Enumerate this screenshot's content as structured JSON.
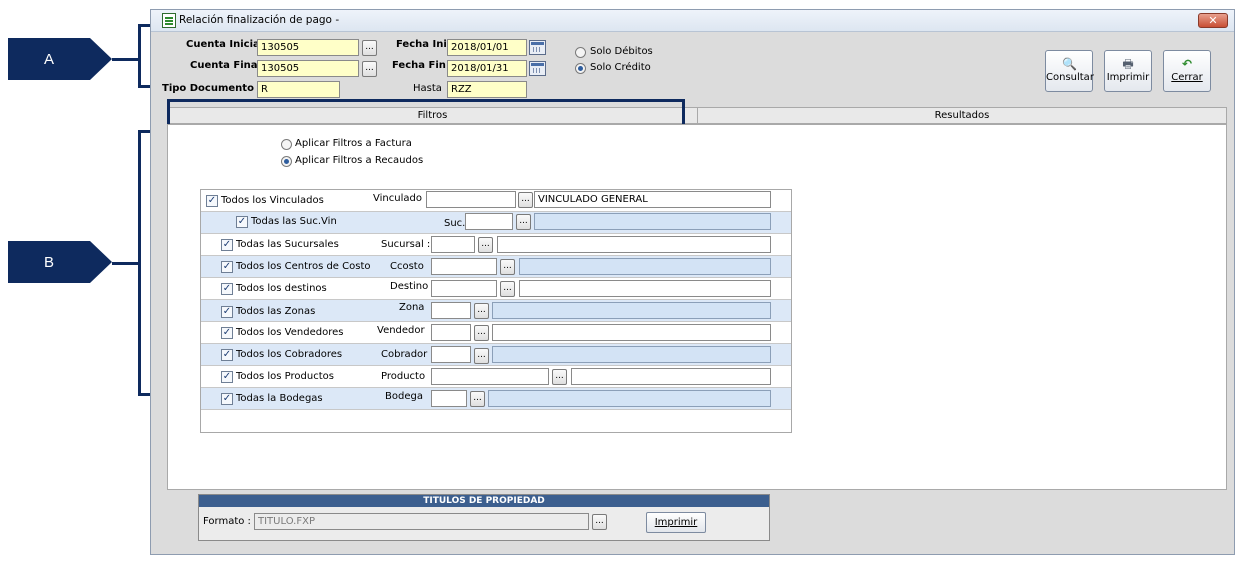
{
  "callouts": {
    "a": "A",
    "b": "B"
  },
  "window": {
    "title": "Relación finalización de pago -",
    "close_icon": "close-icon"
  },
  "header": {
    "cuenta_inicial_label": "Cuenta Inicial :",
    "cuenta_inicial_value": "130505",
    "cuenta_final_label": "Cuenta Final :",
    "cuenta_final_value": "130505",
    "fecha_ini_label": "Fecha Ini :",
    "fecha_ini_value": "2018/01/01",
    "fecha_fin_label": "Fecha Fin :",
    "fecha_fin_value": "2018/01/31",
    "tipo_documento_label": "Tipo Documento :",
    "tipo_documento_value": "R",
    "hasta_label": "Hasta",
    "hasta_value": "RZZ",
    "solo_debitos": "Solo Débitos",
    "solo_credito": "Solo Crédito",
    "dots": "..."
  },
  "toolbar": {
    "consultar": "Consultar",
    "imprimir": "Imprimir",
    "cerrar": "Cerrar"
  },
  "tabs": {
    "filtros": "Filtros",
    "resultados": "Resultados"
  },
  "filters": {
    "aplicar_factura": "Aplicar Filtros a Factura",
    "aplicar_recaudos": "Aplicar Filtros a Recaudos",
    "rows": [
      {
        "check_label": "Todos los Vinculados",
        "field_label": "Vinculado",
        "code": "",
        "desc": "VINCULADO GENERAL"
      },
      {
        "check_label": "Todas las Suc.Vin",
        "field_label": "Suc.",
        "code": "",
        "desc": ""
      },
      {
        "check_label": "Todas las Sucursales",
        "field_label": "Sucursal :",
        "code": "",
        "desc": ""
      },
      {
        "check_label": "Todos los Centros de Costo",
        "field_label": "Ccosto",
        "code": "",
        "desc": ""
      },
      {
        "check_label": "Todos los destinos",
        "field_label": "Destino",
        "code": "",
        "desc": ""
      },
      {
        "check_label": "Todos las Zonas",
        "field_label": "Zona",
        "code": "",
        "desc": ""
      },
      {
        "check_label": "Todos los Vendedores",
        "field_label": "Vendedor",
        "code": "",
        "desc": ""
      },
      {
        "check_label": "Todos los Cobradores",
        "field_label": "Cobrador",
        "code": "",
        "desc": ""
      },
      {
        "check_label": "Todos los Productos",
        "field_label": "Producto",
        "code": "",
        "desc": ""
      },
      {
        "check_label": "Todas la Bodegas",
        "field_label": "Bodega",
        "code": "",
        "desc": ""
      }
    ]
  },
  "titulos": {
    "heading": "TITULOS DE PROPIEDAD",
    "formato_label": "Formato :",
    "formato_value": "TITULO.FXP",
    "imprimir": "Imprimir"
  },
  "checkmark": "✓"
}
